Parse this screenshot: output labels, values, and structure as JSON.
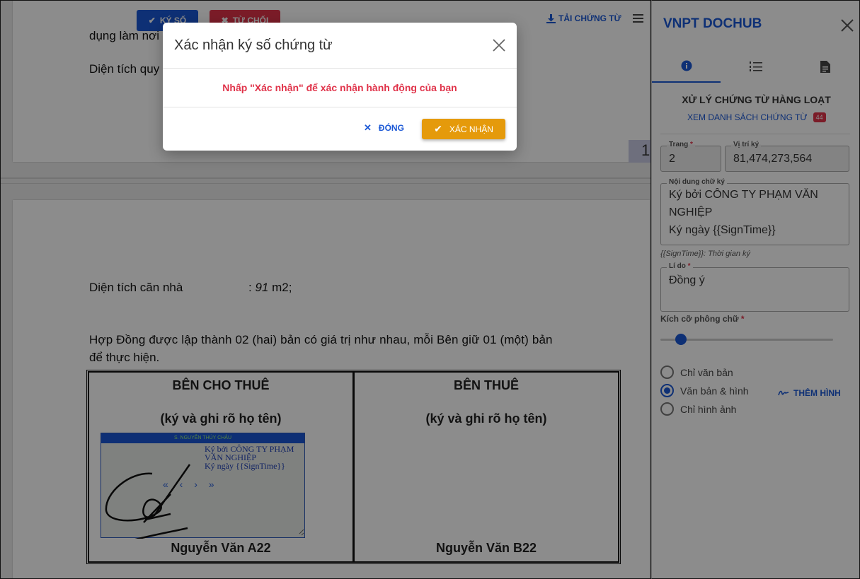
{
  "toolbar": {
    "sign_label": "KÝ SỐ",
    "reject_label": "TỪ CHỐI",
    "download_label": "TẢI CHỨNG TỪ"
  },
  "document": {
    "page1_line1": "dụng làm nơi",
    "page1_line2": "Diện tích quy",
    "page_number": "1",
    "area_label": "Diện tích căn nhà",
    "area_colon": ":",
    "area_value": "91",
    "area_unit": "m2;",
    "para_line1": "Hợp Đồng được lập thành 02 (hai) bản có giá trị như nhau, mỗi Bên giữ 01 (một) bản",
    "para_line2": "để thực hiện.",
    "left_col_title": "BÊN CHO THUÊ",
    "left_col_sub": "(ký và ghi rõ họ tên)",
    "left_col_name": "Nguyễn Văn A22",
    "right_col_title": "BÊN THUÊ",
    "right_col_sub": "(ký và ghi rõ họ tên)",
    "right_col_name": "Nguyễn Văn B22",
    "sig_box_header": "S. NGUYỄN THÚY CHÂU",
    "sig_box_line1": "Ký bởi CÔNG TY PHẠM",
    "sig_box_line2": "VĂN NGHIỆP",
    "sig_box_line3": "Ký ngày {{SignTime}}",
    "sig_nav": "« ‹ › »"
  },
  "panel": {
    "title": "VNPT DOCHUB",
    "sub_title": "XỬ LÝ CHỨNG TỪ HÀNG LOẠT",
    "list_link": "XEM DANH SÁCH CHỨNG TỪ",
    "list_count": "44",
    "page_label": "Trang",
    "page_value": "2",
    "position_label": "Vị trí ký",
    "position_value": "81,474,273,564",
    "content_label": "Nội dung chữ ký",
    "content_line1": "Ký bởi CÔNG TY PHẠM VĂN",
    "content_line2": "NGHIỆP",
    "content_line3": "Ký ngày {{SignTime}}",
    "hint": "{{SignTime}}: Thời gian ký",
    "reason_label": "Lí do",
    "reason_value": "Đồng ý",
    "font_size_label": "Kích cỡ phông chữ",
    "font_size_level": 0.12,
    "radio_options": [
      "Chỉ văn bản",
      "Văn bản & hình",
      "Chỉ hình ảnh"
    ],
    "radio_selected": "Văn bản & hình",
    "add_image_label": "THÊM HÌNH"
  },
  "modal": {
    "title": "Xác nhận ký số chứng từ",
    "message": "Nhấp \"Xác nhận\" để xác nhận hành động của bạn",
    "close_label": "ĐÓNG",
    "confirm_label": "XÁC NHẬN"
  },
  "colors": {
    "primary": "#1b58d6",
    "danger": "#e0334a",
    "confirm": "#e59a0b"
  }
}
